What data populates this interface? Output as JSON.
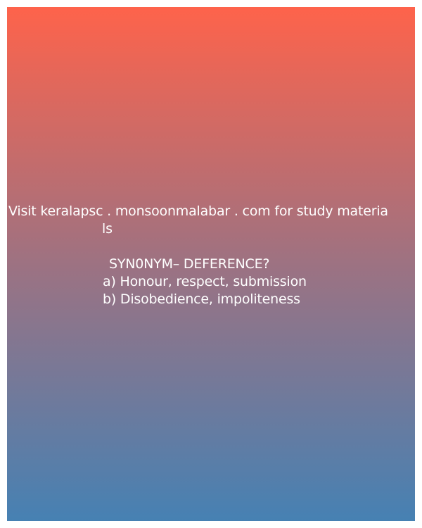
{
  "promo": {
    "line1": "Visit keralapsc . monsoonmalabar . com for study materia",
    "line2": "ls"
  },
  "question": {
    "text": "SYN0NYM– DEFERENCE?",
    "options": [
      "a) Honour, respect, submission",
      "b) Disobedience, impoliteness"
    ]
  },
  "colors": {
    "gradient_top": "#fe634b",
    "gradient_mid": "#9d7282",
    "gradient_bottom": "#4681b3",
    "text": "#ffffff"
  }
}
